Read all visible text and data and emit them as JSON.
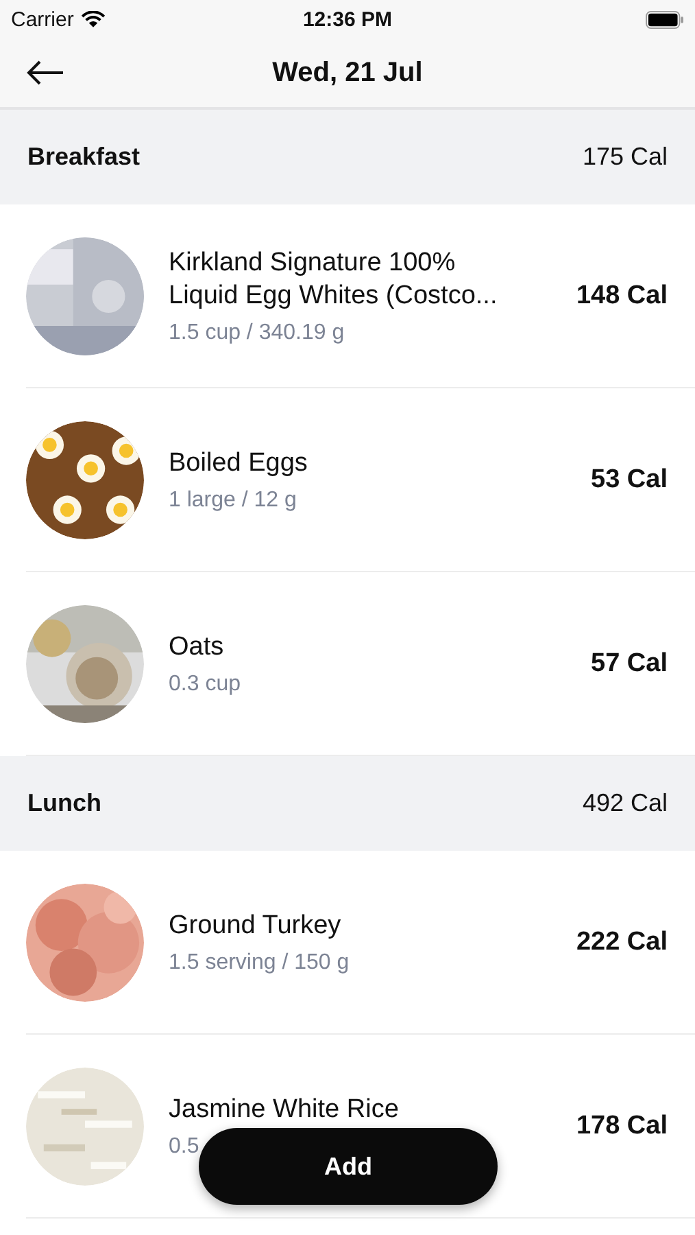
{
  "status_bar": {
    "carrier": "Carrier",
    "time": "12:36 PM"
  },
  "header": {
    "title": "Wed, 21 Jul"
  },
  "meals": [
    {
      "name": "Breakfast",
      "calories": "175 Cal",
      "items": [
        {
          "name": "Kirkland Signature 100% Liquid Egg Whites (Costco...",
          "amount": "1.5 cup / 340.19 g",
          "calories": "148 Cal"
        },
        {
          "name": "Boiled Eggs",
          "amount": "1 large / 12 g",
          "calories": "53 Cal"
        },
        {
          "name": "Oats",
          "amount": "0.3 cup",
          "calories": "57 Cal"
        }
      ]
    },
    {
      "name": "Lunch",
      "calories": "492 Cal",
      "items": [
        {
          "name": "Ground Turkey",
          "amount": "1.5 serving / 150 g",
          "calories": "222 Cal"
        },
        {
          "name": "Jasmine White Rice",
          "amount": "0.5",
          "calories": "178 Cal"
        }
      ]
    }
  ],
  "add_button": "Add"
}
